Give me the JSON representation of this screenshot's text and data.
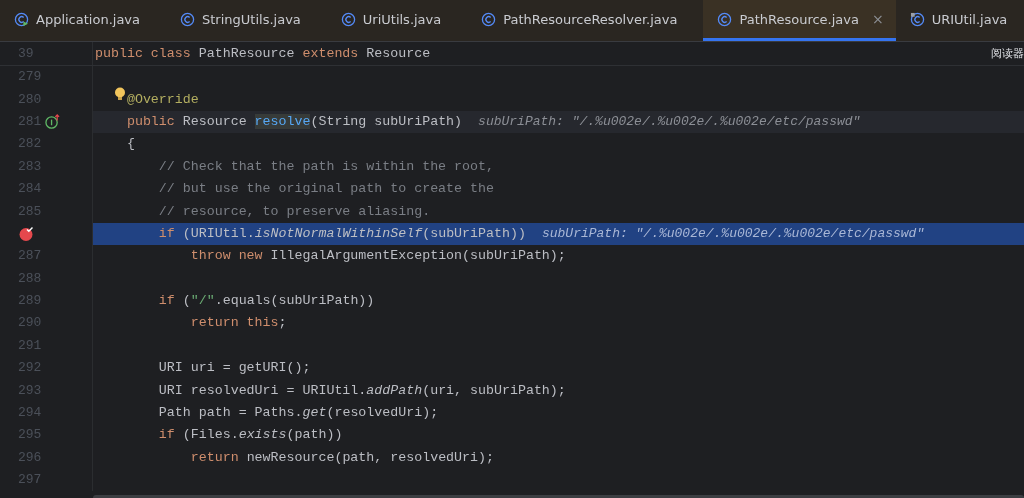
{
  "tabs": [
    {
      "label": "Application.java",
      "selected": false,
      "kind": "runnable"
    },
    {
      "label": "StringUtils.java",
      "selected": false,
      "kind": "plain"
    },
    {
      "label": "UriUtils.java",
      "selected": false,
      "kind": "plain"
    },
    {
      "label": "PathResourceResolver.java",
      "selected": false,
      "kind": "plain"
    },
    {
      "label": "PathResource.java",
      "selected": true,
      "kind": "plain",
      "close": "×"
    },
    {
      "label": "URIUtil.java",
      "selected": false,
      "kind": "library"
    }
  ],
  "side_label": "阅读器",
  "sticky_header": {
    "number": "39",
    "tokens": [
      {
        "kind": "keyword",
        "text": "public class "
      },
      {
        "kind": "plain",
        "text": "PathResource "
      },
      {
        "kind": "keyword",
        "text": "extends "
      },
      {
        "kind": "plain",
        "text": "Resource"
      }
    ]
  },
  "lines": [
    {
      "number": "279"
    },
    {
      "number": "280",
      "kind": "bulb",
      "tokens": [
        {
          "kind": "annotation",
          "text": "    @Override"
        }
      ]
    },
    {
      "number": "281",
      "caret": true,
      "kind": "override",
      "tokens": [
        {
          "kind": "keyword",
          "text": "    public "
        },
        {
          "kind": "plain",
          "text": "Resource "
        },
        {
          "kind": "reference",
          "text": "resolve"
        },
        {
          "kind": "plain",
          "text": "(String subUriPath)"
        }
      ],
      "hint": "subUriPath: \"/.%u002e/.%u002e/.%u002e/etc/passwd\""
    },
    {
      "number": "282",
      "tokens": [
        {
          "kind": "plain",
          "text": "    {"
        }
      ]
    },
    {
      "number": "283",
      "tokens": [
        {
          "kind": "comment",
          "text": "        // Check that the path is within the root,"
        }
      ]
    },
    {
      "number": "284",
      "tokens": [
        {
          "kind": "comment",
          "text": "        // but use the original path to create the"
        }
      ]
    },
    {
      "number": "285",
      "tokens": [
        {
          "kind": "comment",
          "text": "        // resource, to preserve aliasing."
        }
      ]
    },
    {
      "highlighted": true,
      "kind": "breakpoint",
      "tokens": [
        {
          "kind": "keyword",
          "text": "        if "
        },
        {
          "kind": "plain",
          "text": "(URIUtil."
        },
        {
          "kind": "static",
          "text": "isNotNormalWithinSelf"
        },
        {
          "kind": "plain",
          "text": "(subUriPath))"
        }
      ],
      "hint": "subUriPath: \"/.%u002e/.%u002e/.%u002e/etc/passwd\""
    },
    {
      "number": "287",
      "tokens": [
        {
          "kind": "keyword",
          "text": "            throw new "
        },
        {
          "kind": "plain",
          "text": "IllegalArgumentException(subUriPath);"
        }
      ]
    },
    {
      "number": "288"
    },
    {
      "number": "289",
      "tokens": [
        {
          "kind": "keyword",
          "text": "        if "
        },
        {
          "kind": "plain",
          "text": "("
        },
        {
          "kind": "string",
          "text": "\"/\""
        },
        {
          "kind": "plain",
          "text": ".equals(subUriPath))"
        }
      ]
    },
    {
      "number": "290",
      "tokens": [
        {
          "kind": "keyword",
          "text": "            return this"
        },
        {
          "kind": "plain",
          "text": ";"
        }
      ]
    },
    {
      "number": "291"
    },
    {
      "number": "292",
      "tokens": [
        {
          "kind": "plain",
          "text": "        URI uri = getURI();"
        }
      ]
    },
    {
      "number": "293",
      "tokens": [
        {
          "kind": "plain",
          "text": "        URI resolvedUri = URIUtil."
        },
        {
          "kind": "static",
          "text": "addPath"
        },
        {
          "kind": "plain",
          "text": "(uri, subUriPath);"
        }
      ]
    },
    {
      "number": "294",
      "tokens": [
        {
          "kind": "plain",
          "text": "        Path path = Paths."
        },
        {
          "kind": "static",
          "text": "get"
        },
        {
          "kind": "plain",
          "text": "(resolvedUri);"
        }
      ]
    },
    {
      "number": "295",
      "tokens": [
        {
          "kind": "keyword",
          "text": "        if "
        },
        {
          "kind": "plain",
          "text": "(Files."
        },
        {
          "kind": "static",
          "text": "exists"
        },
        {
          "kind": "plain",
          "text": "(path))"
        }
      ]
    },
    {
      "number": "296",
      "tokens": [
        {
          "kind": "keyword",
          "text": "            return "
        },
        {
          "kind": "plain",
          "text": "newResource(path, resolvedUri);"
        }
      ]
    },
    {
      "number": "297"
    }
  ]
}
